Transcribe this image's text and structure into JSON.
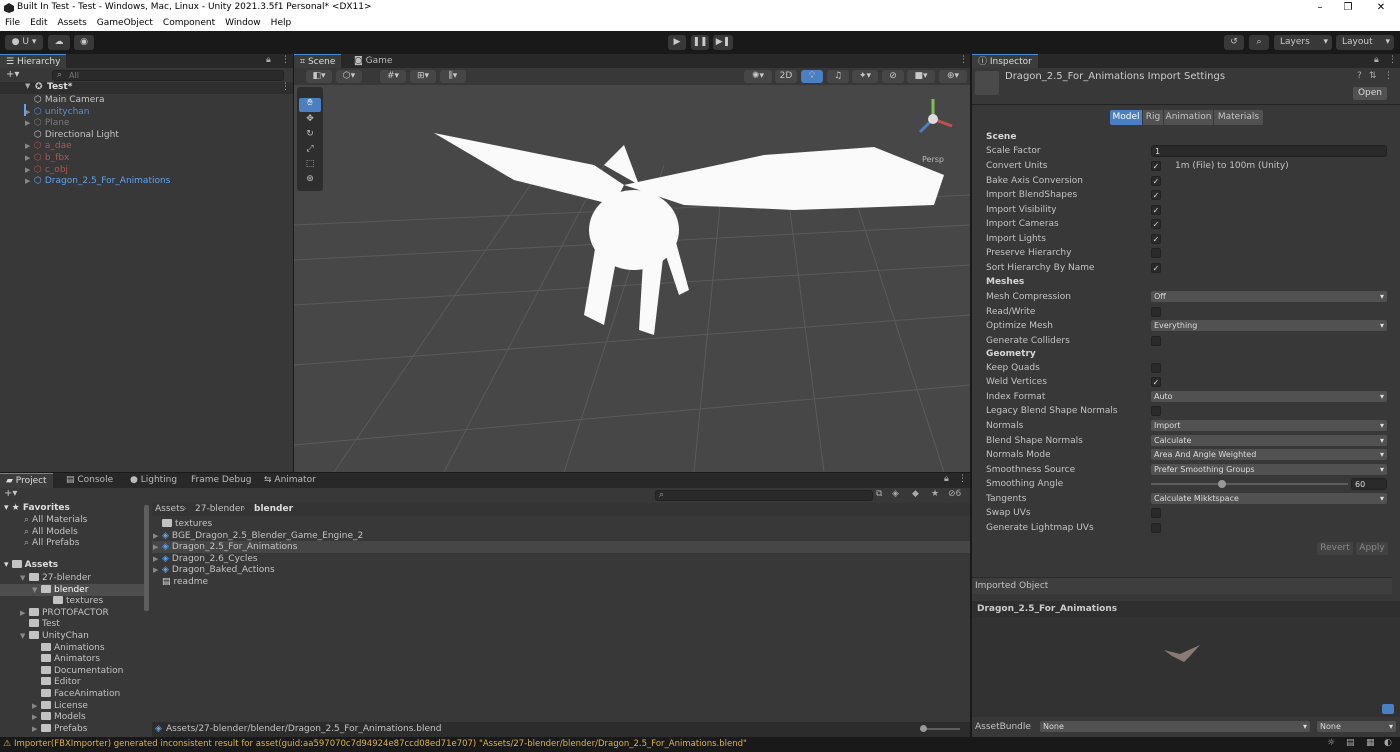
{
  "window": {
    "title": "Built In Test - Test - Windows, Mac, Linux - Unity 2021.3.5f1 Personal* <DX11>",
    "minimize": "–",
    "maximize": "❐",
    "close": "✕"
  },
  "menu": [
    "File",
    "Edit",
    "Assets",
    "GameObject",
    "Component",
    "Window",
    "Help"
  ],
  "toolbar": {
    "account": "U",
    "layers": "Layers",
    "layout": "Layout"
  },
  "hierarchy": {
    "tab": "Hierarchy",
    "search_placeholder": "All",
    "scene": "Test*",
    "items": [
      {
        "label": "Main Camera",
        "color": "#c4c4c4"
      },
      {
        "label": "unitychan",
        "color": "#5b8dd0"
      },
      {
        "label": "Plane",
        "color": "#7a7a7a"
      },
      {
        "label": "Directional Light",
        "color": "#c4c4c4"
      },
      {
        "label": "a_dae",
        "color": "#b55252"
      },
      {
        "label": "b_fbx",
        "color": "#b55252"
      },
      {
        "label": "c_obj",
        "color": "#b55252"
      },
      {
        "label": "Dragon_2.5_For_Animations",
        "color": "#5ea3f0"
      }
    ]
  },
  "scene": {
    "tab_scene": "Scene",
    "tab_game": "Game",
    "btn_2d": "2D",
    "persp": "Persp"
  },
  "inspector": {
    "tab": "Inspector",
    "title": "Dragon_2.5_For_Animations Import Settings",
    "open": "Open",
    "tabs": [
      "Model",
      "Rig",
      "Animation",
      "Materials"
    ],
    "section_scene": "Scene",
    "scale_factor_label": "Scale Factor",
    "scale_factor_value": "1",
    "convert_units_label": "Convert Units",
    "convert_units_note": "1m (File) to 100m (Unity)",
    "bake_axis": "Bake Axis Conversion",
    "import_blend": "Import BlendShapes",
    "import_vis": "Import Visibility",
    "import_cams": "Import Cameras",
    "import_lights": "Import Lights",
    "preserve_hier": "Preserve Hierarchy",
    "sort_hier": "Sort Hierarchy By Name",
    "section_meshes": "Meshes",
    "mesh_comp_label": "Mesh Compression",
    "mesh_comp_value": "Off",
    "read_write": "Read/Write",
    "opt_mesh_label": "Optimize Mesh",
    "opt_mesh_value": "Everything",
    "gen_colliders": "Generate Colliders",
    "section_geometry": "Geometry",
    "keep_quads": "Keep Quads",
    "weld": "Weld Vertices",
    "index_label": "Index Format",
    "index_value": "Auto",
    "legacy": "Legacy Blend Shape Normals",
    "normals_label": "Normals",
    "normals_value": "Import",
    "bsn_label": "Blend Shape Normals",
    "bsn_value": "Calculate",
    "nm_label": "Normals Mode",
    "nm_value": "Area And Angle Weighted",
    "ss_label": "Smoothness Source",
    "ss_value": "Prefer Smoothing Groups",
    "sa_label": "Smoothing Angle",
    "sa_value": "60",
    "sa_fraction": 0.36,
    "tan_label": "Tangents",
    "tan_value": "Calculate Mikktspace",
    "swap_uvs": "Swap UVs",
    "gen_lightmap": "Generate Lightmap UVs",
    "revert": "Revert",
    "apply": "Apply",
    "imported_object": "Imported Object",
    "preview_name": "Dragon_2.5_For_Animations",
    "assetbundle_label": "AssetBundle",
    "assetbundle_value": "None",
    "assetbundle_variant": "None"
  },
  "project": {
    "tabs": [
      "Project",
      "Console",
      "Lighting",
      "Frame Debug",
      "Animator"
    ],
    "favorites": "Favorites",
    "fav_items": [
      "All Materials",
      "All Models",
      "All Prefabs"
    ],
    "assets": "Assets",
    "tree": [
      {
        "label": "27-blender",
        "depth": 1
      },
      {
        "label": "blender",
        "depth": 2
      },
      {
        "label": "textures",
        "depth": 3
      },
      {
        "label": "PROTOFACTOR",
        "depth": 1
      },
      {
        "label": "Test",
        "depth": 1
      },
      {
        "label": "UnityChan",
        "depth": 1
      },
      {
        "label": "Animations",
        "depth": 2
      },
      {
        "label": "Animators",
        "depth": 2
      },
      {
        "label": "Documentation",
        "depth": 2
      },
      {
        "label": "Editor",
        "depth": 2
      },
      {
        "label": "FaceAnimation",
        "depth": 2
      },
      {
        "label": "License",
        "depth": 2
      },
      {
        "label": "Models",
        "depth": 2
      },
      {
        "label": "Prefabs",
        "depth": 2
      }
    ],
    "breadcrumb": [
      "Assets",
      "27-blender",
      "blender"
    ],
    "files": [
      "textures",
      "BGE_Dragon_2.5_Blender_Game_Engine_2",
      "Dragon_2.5_For_Animations",
      "Dragon_2.6_Cycles",
      "Dragon_Baked_Actions",
      "readme"
    ],
    "path": "Assets/27-blender/blender/Dragon_2.5_For_Animations.blend",
    "hidden_count": "6"
  },
  "status": "Importer(FBXImporter) generated inconsistent result for asset(guid:aa597070c7d94924e87ccd08ed71e707) \"Assets/27-blender/blender/Dragon_2.5_For_Animations.blend\""
}
